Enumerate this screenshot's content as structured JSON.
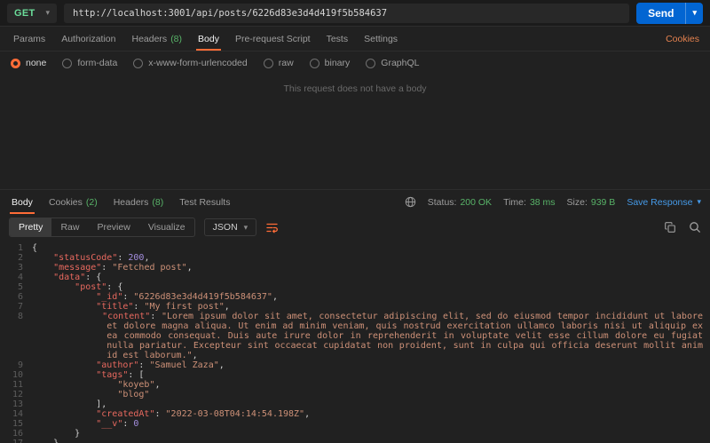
{
  "colors": {
    "accent_orange": "#ff6c37",
    "send_button_blue": "#0265d2",
    "method_get_green": "#6bdd9a",
    "status_green": "#58b368",
    "link_blue": "#459ae8"
  },
  "icons": {
    "chevron_down": "▾"
  },
  "request": {
    "method": "GET",
    "url": "http://localhost:3001/api/posts/6226d83e3d4d419f5b584637",
    "send_label": "Send",
    "cookies_link": "Cookies",
    "tabs": [
      {
        "label": "Params"
      },
      {
        "label": "Authorization"
      },
      {
        "label": "Headers",
        "count": "(8)"
      },
      {
        "label": "Body",
        "active": true
      },
      {
        "label": "Pre-request Script"
      },
      {
        "label": "Tests"
      },
      {
        "label": "Settings"
      }
    ],
    "body_types": [
      {
        "label": "none",
        "selected": true
      },
      {
        "label": "form-data"
      },
      {
        "label": "x-www-form-urlencoded"
      },
      {
        "label": "raw"
      },
      {
        "label": "binary"
      },
      {
        "label": "GraphQL"
      }
    ],
    "empty_body_message": "This request does not have a body"
  },
  "response": {
    "tabs": [
      {
        "label": "Body",
        "active": true
      },
      {
        "label": "Cookies",
        "count": "(2)"
      },
      {
        "label": "Headers",
        "count": "(8)"
      },
      {
        "label": "Test Results"
      }
    ],
    "meta": {
      "status_label": "Status:",
      "status_value": "200 OK",
      "time_label": "Time:",
      "time_value": "38 ms",
      "size_label": "Size:",
      "size_value": "939 B"
    },
    "save_response_label": "Save Response",
    "view_tabs": [
      {
        "label": "Pretty",
        "active": true
      },
      {
        "label": "Raw"
      },
      {
        "label": "Preview"
      },
      {
        "label": "Visualize"
      }
    ],
    "format_label": "JSON",
    "code": {
      "lines": [
        {
          "n": 1,
          "seg": [
            [
              "p",
              "{"
            ]
          ]
        },
        {
          "n": 2,
          "seg": [
            [
              "p",
              "    "
            ],
            [
              "k",
              "\"statusCode\""
            ],
            [
              "p",
              ": "
            ],
            [
              "n",
              "200"
            ],
            [
              "p",
              ","
            ]
          ]
        },
        {
          "n": 3,
          "seg": [
            [
              "p",
              "    "
            ],
            [
              "k",
              "\"message\""
            ],
            [
              "p",
              ": "
            ],
            [
              "s",
              "\"Fetched post\""
            ],
            [
              "p",
              ","
            ]
          ]
        },
        {
          "n": 4,
          "seg": [
            [
              "p",
              "    "
            ],
            [
              "k",
              "\"data\""
            ],
            [
              "p",
              ": {"
            ]
          ]
        },
        {
          "n": 5,
          "seg": [
            [
              "p",
              "        "
            ],
            [
              "k",
              "\"post\""
            ],
            [
              "p",
              ": {"
            ]
          ]
        },
        {
          "n": 6,
          "seg": [
            [
              "p",
              "            "
            ],
            [
              "k",
              "\"_id\""
            ],
            [
              "p",
              ": "
            ],
            [
              "s",
              "\"6226d83e3d4d419f5b584637\""
            ],
            [
              "p",
              ","
            ]
          ]
        },
        {
          "n": 7,
          "seg": [
            [
              "p",
              "            "
            ],
            [
              "k",
              "\"title\""
            ],
            [
              "p",
              ": "
            ],
            [
              "s",
              "\"My first post\""
            ],
            [
              "p",
              ","
            ]
          ]
        },
        {
          "n": 8,
          "hang": 14,
          "justify": true,
          "seg": [
            [
              "p",
              "            "
            ],
            [
              "k",
              "\"content\""
            ],
            [
              "p",
              ": "
            ],
            [
              "s",
              "\"Lorem ipsum dolor sit amet, consectetur adipiscing elit, sed do eiusmod tempor incididunt ut labore et dolore magna aliqua. Ut enim ad minim veniam, quis nostrud exercitation ullamco laboris nisi ut aliquip ex ea commodo consequat. Duis aute irure dolor in reprehenderit in voluptate velit esse cillum dolore eu fugiat nulla pariatur. Excepteur sint occaecat cupidatat non proident, sunt in culpa qui officia deserunt mollit anim id est laborum.\""
            ],
            [
              "p",
              ","
            ]
          ]
        },
        {
          "n": 9,
          "seg": [
            [
              "p",
              "            "
            ],
            [
              "k",
              "\"author\""
            ],
            [
              "p",
              ": "
            ],
            [
              "s",
              "\"Samuel Zaza\""
            ],
            [
              "p",
              ","
            ]
          ]
        },
        {
          "n": 10,
          "seg": [
            [
              "p",
              "            "
            ],
            [
              "k",
              "\"tags\""
            ],
            [
              "p",
              ": ["
            ]
          ]
        },
        {
          "n": 11,
          "seg": [
            [
              "p",
              "                "
            ],
            [
              "s",
              "\"koyeb\""
            ],
            [
              "p",
              ","
            ]
          ]
        },
        {
          "n": 12,
          "seg": [
            [
              "p",
              "                "
            ],
            [
              "s",
              "\"blog\""
            ]
          ]
        },
        {
          "n": 13,
          "seg": [
            [
              "p",
              "            ],"
            ]
          ]
        },
        {
          "n": 14,
          "seg": [
            [
              "p",
              "            "
            ],
            [
              "k",
              "\"createdAt\""
            ],
            [
              "p",
              ": "
            ],
            [
              "s",
              "\"2022-03-08T04:14:54.198Z\""
            ],
            [
              "p",
              ","
            ]
          ]
        },
        {
          "n": 15,
          "seg": [
            [
              "p",
              "            "
            ],
            [
              "k",
              "\"__v\""
            ],
            [
              "p",
              ": "
            ],
            [
              "n",
              "0"
            ]
          ]
        },
        {
          "n": 16,
          "seg": [
            [
              "p",
              "        }"
            ]
          ]
        },
        {
          "n": 17,
          "seg": [
            [
              "p",
              "    }"
            ]
          ]
        }
      ]
    }
  }
}
